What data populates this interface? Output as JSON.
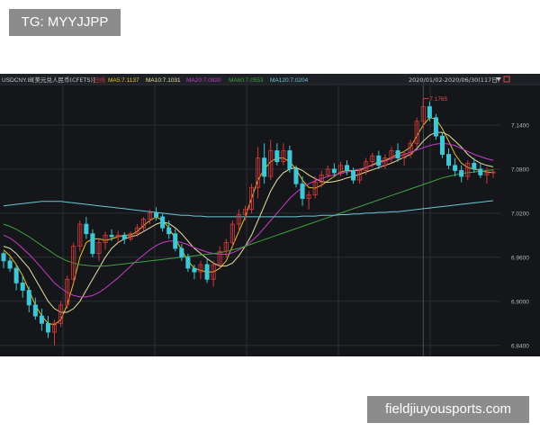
{
  "watermark_top": "TG: MYYJJPP",
  "watermark_bottom": "fieldjiuyousports.com",
  "chart_data": {
    "type": "candlestick",
    "symbol": "USDCNY.IB",
    "symbol_name": "[美元兑人民币(CFETS)]",
    "period_tag": "日线",
    "range_text": "2020/01/02-2020/06/30(117日)",
    "indicators": [
      {
        "name": "MA5",
        "label": "MA5:7.1137",
        "color": "#e6c229"
      },
      {
        "name": "MA10",
        "label": "MA10:7.1031",
        "color": "#e8e0a0"
      },
      {
        "name": "MA20",
        "label": "MA20:7.0920",
        "color": "#c83cc8"
      },
      {
        "name": "MA60",
        "label": "MA60:7.0553",
        "color": "#3fa23f"
      },
      {
        "name": "MA120",
        "label": "MA120:7.0204",
        "color": "#6ec6d6"
      }
    ],
    "y_ticks": [
      "7.1400",
      "7.0800",
      "7.0200",
      "6.9600",
      "6.9000",
      "6.8400"
    ],
    "ylim": [
      6.825,
      7.195
    ],
    "high_label": "7.1765",
    "low_label": "6.8398",
    "up_color": "#d23a3a",
    "down_color": "#3fc7d6",
    "candles_ohlc": [
      [
        6.965,
        6.968,
        6.945,
        6.955
      ],
      [
        6.955,
        6.96,
        6.94,
        6.945
      ],
      [
        6.945,
        6.95,
        6.915,
        6.925
      ],
      [
        6.925,
        6.935,
        6.905,
        6.915
      ],
      [
        6.915,
        6.92,
        6.885,
        6.895
      ],
      [
        6.895,
        6.905,
        6.875,
        6.88
      ],
      [
        6.88,
        6.89,
        6.86,
        6.87
      ],
      [
        6.87,
        6.88,
        6.85,
        6.858
      ],
      [
        6.858,
        6.875,
        6.84,
        6.87
      ],
      [
        6.87,
        6.9,
        6.865,
        6.895
      ],
      [
        6.895,
        6.935,
        6.89,
        6.93
      ],
      [
        6.93,
        6.98,
        6.925,
        6.975
      ],
      [
        6.975,
        7.01,
        6.968,
        7.005
      ],
      [
        7.005,
        7.015,
        6.985,
        6.992
      ],
      [
        6.992,
        6.998,
        6.96,
        6.965
      ],
      [
        6.965,
        6.985,
        6.955,
        6.98
      ],
      [
        6.98,
        6.995,
        6.97,
        6.99
      ],
      [
        6.99,
        6.998,
        6.982,
        6.988
      ],
      [
        6.988,
        6.996,
        6.98,
        6.99
      ],
      [
        6.99,
        6.994,
        6.978,
        6.985
      ],
      [
        6.985,
        6.995,
        6.982,
        6.992
      ],
      [
        6.992,
        7.005,
        6.988,
        7.0
      ],
      [
        7.0,
        7.015,
        6.995,
        7.012
      ],
      [
        7.012,
        7.025,
        7.005,
        7.02
      ],
      [
        7.02,
        7.028,
        7.01,
        7.015
      ],
      [
        7.015,
        7.02,
        6.995,
        7.0
      ],
      [
        7.0,
        7.01,
        6.985,
        6.992
      ],
      [
        6.992,
        6.998,
        6.968,
        6.972
      ],
      [
        6.972,
        6.978,
        6.955,
        6.96
      ],
      [
        6.96,
        6.965,
        6.94,
        6.945
      ],
      [
        6.945,
        6.95,
        6.93,
        6.94
      ],
      [
        6.94,
        6.955,
        6.93,
        6.95
      ],
      [
        6.95,
        6.958,
        6.925,
        6.93
      ],
      [
        6.93,
        6.955,
        6.92,
        6.95
      ],
      [
        6.95,
        6.975,
        6.945,
        6.968
      ],
      [
        6.968,
        6.985,
        6.96,
        6.98
      ],
      [
        6.98,
        7.01,
        6.975,
        7.005
      ],
      [
        7.005,
        7.025,
        6.995,
        7.018
      ],
      [
        7.018,
        7.03,
        7.01,
        7.025
      ],
      [
        7.025,
        7.06,
        7.02,
        7.055
      ],
      [
        7.055,
        7.11,
        7.04,
        7.095
      ],
      [
        7.095,
        7.115,
        7.06,
        7.07
      ],
      [
        7.07,
        7.12,
        7.065,
        7.105
      ],
      [
        7.105,
        7.115,
        7.085,
        7.09
      ],
      [
        7.09,
        7.115,
        7.085,
        7.105
      ],
      [
        7.105,
        7.112,
        7.075,
        7.08
      ],
      [
        7.08,
        7.085,
        7.055,
        7.06
      ],
      [
        7.06,
        7.07,
        7.03,
        7.04
      ],
      [
        7.04,
        7.05,
        7.025,
        7.045
      ],
      [
        7.045,
        7.07,
        7.04,
        7.062
      ],
      [
        7.062,
        7.078,
        7.055,
        7.072
      ],
      [
        7.072,
        7.085,
        7.068,
        7.08
      ],
      [
        7.08,
        7.088,
        7.07,
        7.075
      ],
      [
        7.075,
        7.09,
        7.07,
        7.085
      ],
      [
        7.085,
        7.092,
        7.072,
        7.078
      ],
      [
        7.078,
        7.082,
        7.06,
        7.065
      ],
      [
        7.065,
        7.08,
        7.06,
        7.078
      ],
      [
        7.078,
        7.095,
        7.072,
        7.09
      ],
      [
        7.09,
        7.102,
        7.082,
        7.098
      ],
      [
        7.098,
        7.105,
        7.08,
        7.085
      ],
      [
        7.085,
        7.1,
        7.08,
        7.095
      ],
      [
        7.095,
        7.11,
        7.088,
        7.105
      ],
      [
        7.105,
        7.115,
        7.09,
        7.095
      ],
      [
        7.095,
        7.105,
        7.085,
        7.1
      ],
      [
        7.1,
        7.12,
        7.095,
        7.115
      ],
      [
        7.115,
        7.15,
        7.11,
        7.145
      ],
      [
        7.145,
        7.176,
        7.135,
        7.165
      ],
      [
        7.165,
        7.172,
        7.145,
        7.15
      ],
      [
        7.15,
        7.155,
        7.12,
        7.125
      ],
      [
        7.125,
        7.13,
        7.095,
        7.1
      ],
      [
        7.1,
        7.108,
        7.08,
        7.085
      ],
      [
        7.085,
        7.095,
        7.07,
        7.078
      ],
      [
        7.078,
        7.085,
        7.062,
        7.07
      ],
      [
        7.07,
        7.092,
        7.065,
        7.088
      ],
      [
        7.088,
        7.095,
        7.075,
        7.08
      ],
      [
        7.08,
        7.088,
        7.068,
        7.072
      ],
      [
        7.072,
        7.082,
        7.06,
        7.075
      ],
      [
        7.075,
        7.08,
        7.068,
        7.076
      ]
    ],
    "ma_curves": [
      {
        "name": "MA5",
        "values": [
          6.97,
          6.962,
          6.95,
          6.935,
          6.915,
          6.895,
          6.88,
          6.87,
          6.868,
          6.875,
          6.895,
          6.925,
          6.96,
          6.98,
          6.985,
          6.985,
          6.983,
          6.985,
          6.988,
          6.99,
          6.99,
          6.995,
          7.003,
          7.01,
          7.015,
          7.01,
          7.0,
          6.985,
          6.97,
          6.955,
          6.945,
          6.942,
          6.94,
          6.94,
          6.945,
          6.955,
          6.975,
          6.995,
          7.015,
          7.04,
          7.065,
          7.08,
          7.09,
          7.095,
          7.095,
          7.09,
          7.08,
          7.065,
          7.055,
          7.054,
          7.058,
          7.064,
          7.07,
          7.076,
          7.078,
          7.078,
          7.078,
          7.082,
          7.086,
          7.09,
          7.092,
          7.096,
          7.1,
          7.104,
          7.11,
          7.125,
          7.14,
          7.15,
          7.148,
          7.135,
          7.118,
          7.1,
          7.088,
          7.082,
          7.08,
          7.078,
          7.076,
          7.075
        ]
      },
      {
        "name": "MA10",
        "values": [
          6.975,
          6.972,
          6.965,
          6.955,
          6.945,
          6.93,
          6.915,
          6.9,
          6.89,
          6.885,
          6.885,
          6.89,
          6.9,
          6.915,
          6.93,
          6.945,
          6.96,
          6.972,
          6.98,
          6.985,
          6.988,
          6.99,
          6.995,
          7.0,
          7.005,
          7.008,
          7.006,
          7.0,
          6.992,
          6.982,
          6.972,
          6.965,
          6.958,
          6.952,
          6.948,
          6.948,
          6.952,
          6.962,
          6.975,
          6.99,
          7.01,
          7.03,
          7.05,
          7.065,
          7.075,
          7.08,
          7.082,
          7.078,
          7.072,
          7.067,
          7.063,
          7.062,
          7.063,
          7.065,
          7.068,
          7.07,
          7.073,
          7.076,
          7.079,
          7.082,
          7.085,
          7.088,
          7.092,
          7.096,
          7.1,
          7.108,
          7.118,
          7.126,
          7.13,
          7.13,
          7.126,
          7.118,
          7.11,
          7.1,
          7.093,
          7.088,
          7.085,
          7.083
        ]
      },
      {
        "name": "MA20",
        "values": [
          6.99,
          6.986,
          6.98,
          6.972,
          6.964,
          6.955,
          6.945,
          6.935,
          6.925,
          6.918,
          6.912,
          6.908,
          6.906,
          6.906,
          6.908,
          6.912,
          6.918,
          6.925,
          6.932,
          6.94,
          6.948,
          6.956,
          6.963,
          6.97,
          6.976,
          6.98,
          6.982,
          6.982,
          6.98,
          6.977,
          6.973,
          6.97,
          6.967,
          6.965,
          6.964,
          6.964,
          6.966,
          6.97,
          6.975,
          6.982,
          6.99,
          7.0,
          7.01,
          7.02,
          7.03,
          7.04,
          7.048,
          7.055,
          7.06,
          7.064,
          7.067,
          7.07,
          7.072,
          7.074,
          7.076,
          7.078,
          7.08,
          7.082,
          7.085,
          7.088,
          7.091,
          7.094,
          7.097,
          7.1,
          7.103,
          7.106,
          7.109,
          7.112,
          7.114,
          7.115,
          7.114,
          7.112,
          7.108,
          7.104,
          7.1,
          7.097,
          7.094,
          7.092
        ]
      },
      {
        "name": "MA60",
        "values": [
          7.005,
          7.002,
          6.998,
          6.993,
          6.988,
          6.982,
          6.976,
          6.97,
          6.964,
          6.959,
          6.955,
          6.952,
          6.95,
          6.949,
          6.948,
          6.948,
          6.948,
          6.949,
          6.95,
          6.951,
          6.952,
          6.953,
          6.954,
          6.955,
          6.956,
          6.957,
          6.958,
          6.959,
          6.96,
          6.961,
          6.962,
          6.963,
          6.964,
          6.965,
          6.966,
          6.968,
          6.97,
          6.972,
          6.975,
          6.978,
          6.981,
          6.984,
          6.987,
          6.99,
          6.993,
          6.996,
          6.999,
          7.002,
          7.005,
          7.008,
          7.011,
          7.014,
          7.017,
          7.02,
          7.023,
          7.026,
          7.029,
          7.032,
          7.035,
          7.038,
          7.041,
          7.044,
          7.047,
          7.05,
          7.053,
          7.056,
          7.059,
          7.062,
          7.065,
          7.068,
          7.07,
          7.072,
          7.074,
          7.075,
          7.076,
          7.077,
          7.078,
          7.079
        ]
      },
      {
        "name": "MA120",
        "values": [
          7.03,
          7.031,
          7.032,
          7.033,
          7.034,
          7.035,
          7.036,
          7.036,
          7.036,
          7.036,
          7.035,
          7.034,
          7.033,
          7.032,
          7.031,
          7.03,
          7.029,
          7.028,
          7.027,
          7.026,
          7.025,
          7.024,
          7.023,
          7.022,
          7.021,
          7.02,
          7.019,
          7.018,
          7.017,
          7.017,
          7.016,
          7.016,
          7.015,
          7.015,
          7.015,
          7.015,
          7.015,
          7.015,
          7.015,
          7.015,
          7.015,
          7.015,
          7.015,
          7.015,
          7.015,
          7.015,
          7.015,
          7.016,
          7.016,
          7.016,
          7.017,
          7.017,
          7.017,
          7.018,
          7.018,
          7.019,
          7.019,
          7.02,
          7.02,
          7.021,
          7.021,
          7.022,
          7.022,
          7.023,
          7.024,
          7.025,
          7.026,
          7.027,
          7.028,
          7.029,
          7.03,
          7.031,
          7.032,
          7.033,
          7.034,
          7.035,
          7.036,
          7.037
        ]
      }
    ]
  }
}
